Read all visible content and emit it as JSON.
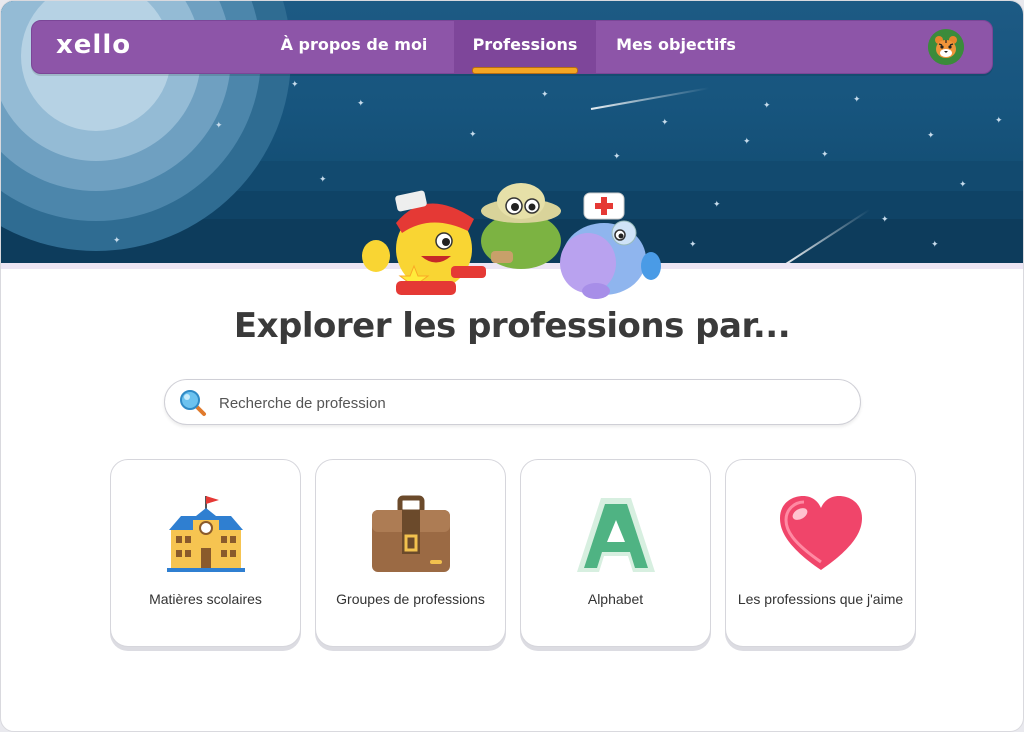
{
  "nav": {
    "logo": "xello",
    "items": [
      {
        "label": "À propos de moi",
        "active": false
      },
      {
        "label": "Professions",
        "active": true
      },
      {
        "label": "Mes objectifs",
        "active": false
      }
    ],
    "avatar_icon": "tiger-avatar-icon"
  },
  "main": {
    "title": "Explorer les professions par...",
    "search": {
      "placeholder": "Recherche de profession",
      "value": ""
    },
    "cards": [
      {
        "label": "Matières scolaires",
        "icon": "school-icon"
      },
      {
        "label": "Groupes de professions",
        "icon": "briefcase-icon"
      },
      {
        "label": "Alphabet",
        "icon": "letter-a-icon"
      },
      {
        "label": "Les professions que j'aime",
        "icon": "heart-icon"
      }
    ]
  },
  "colors": {
    "nav_purple": "#8d55a8",
    "active_underline": "#f5a623",
    "sky": "#17557e",
    "heart": "#f0456a",
    "alphabet_green": "#4fb383",
    "briefcase": "#9b6a44"
  }
}
